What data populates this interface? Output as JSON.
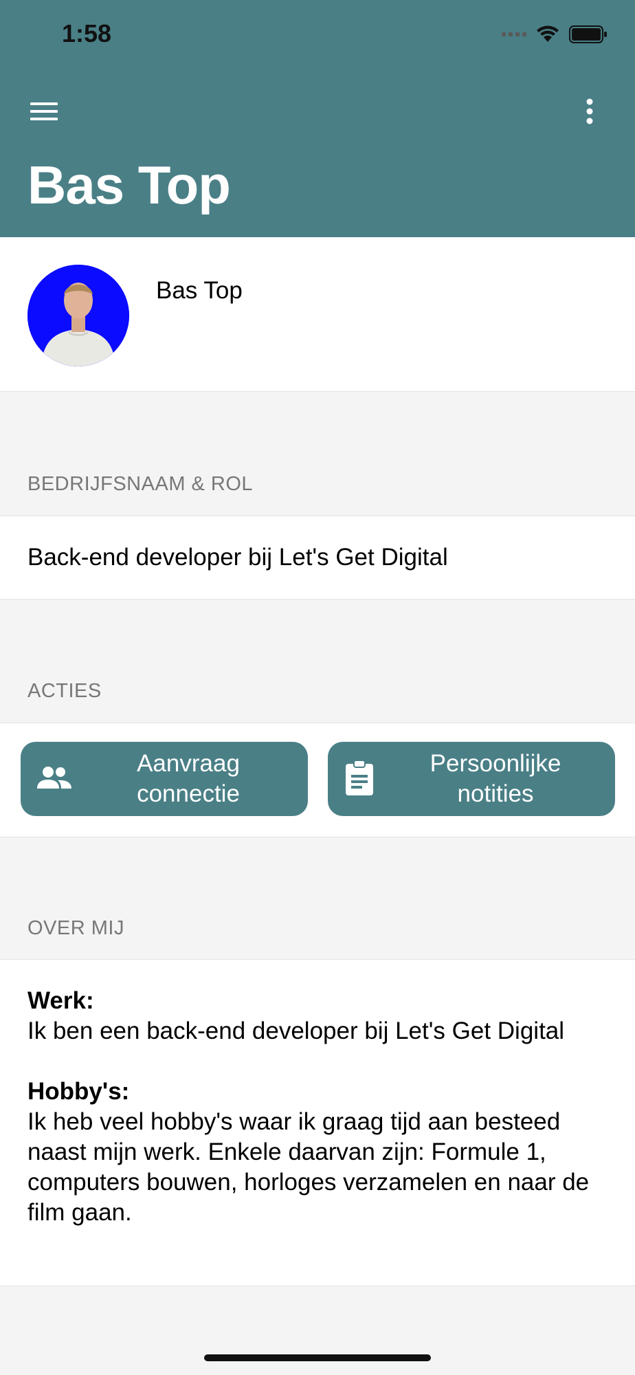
{
  "status": {
    "time": "1:58"
  },
  "header": {
    "title": "Bas Top"
  },
  "profile": {
    "name": "Bas Top"
  },
  "company": {
    "section_label": "BEDRIJFSNAAM & ROL",
    "text": "Back-end developer bij Let's Get Digital"
  },
  "actions": {
    "section_label": "ACTIES",
    "buttons": [
      {
        "line1": "Aanvraag",
        "line2": "connectie",
        "icon": "people-icon"
      },
      {
        "line1": "Persoonlijke",
        "line2": "notities",
        "icon": "clipboard-icon"
      }
    ]
  },
  "about": {
    "section_label": "OVER MIJ",
    "work_heading": "Werk:",
    "work_text": "Ik ben een back-end developer bij Let's Get Digital",
    "hobby_heading": "Hobby's:",
    "hobby_text": "Ik heb veel hobby's waar ik graag tijd aan besteed naast mijn werk. Enkele daarvan zijn: Formule 1, computers bouwen, horloges verzamelen en naar de film gaan."
  },
  "colors": {
    "header": "#4a7f86",
    "button": "#4a7f86",
    "avatar_bg": "#0b0bff"
  }
}
